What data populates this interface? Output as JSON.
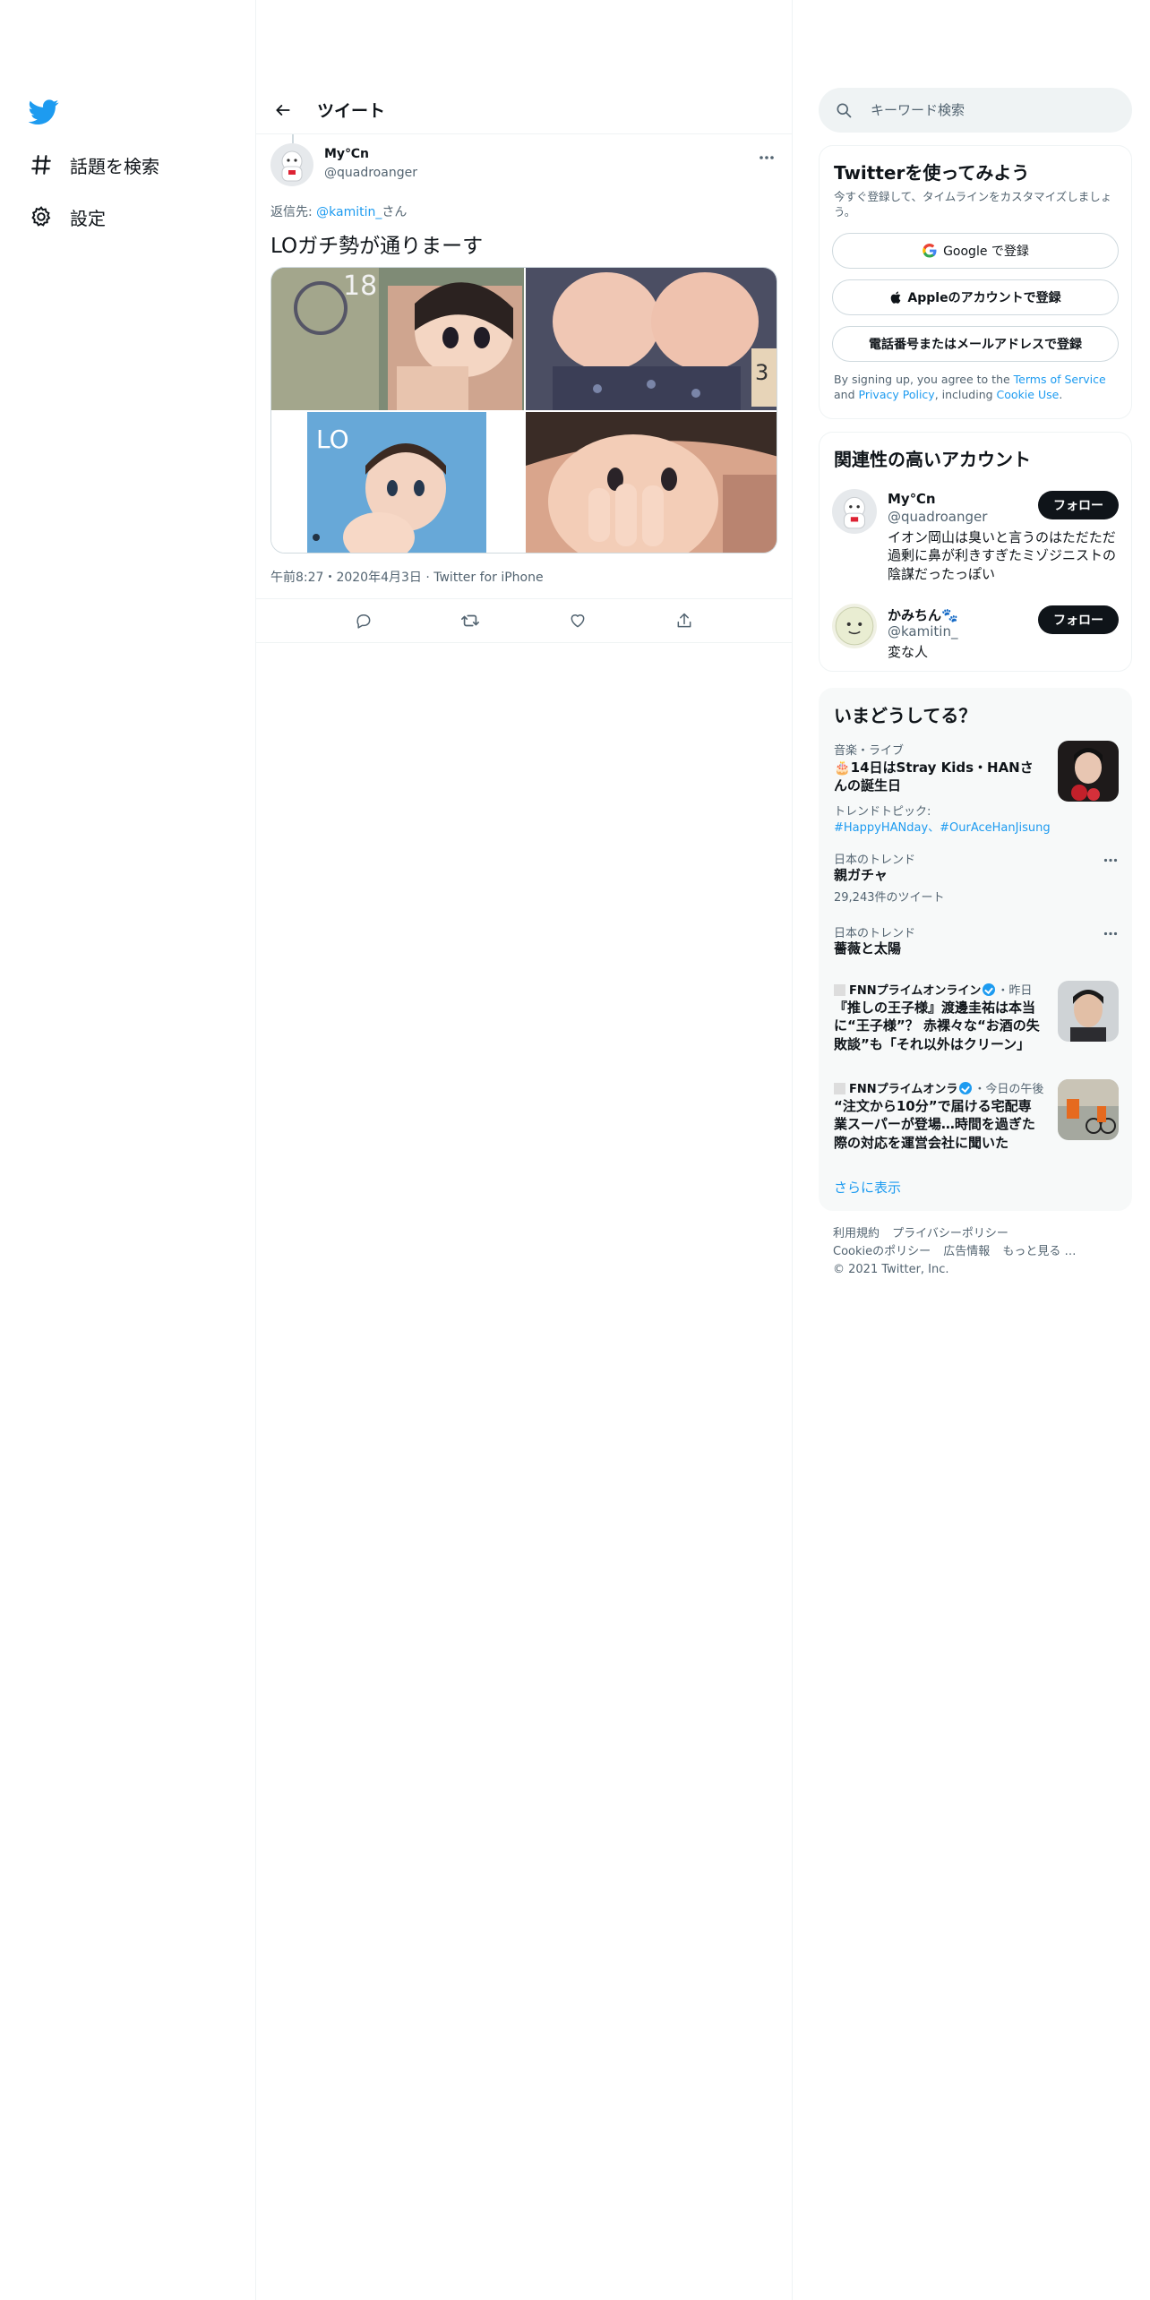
{
  "nav": {
    "explore_label": "話題を検索",
    "settings_label": "設定"
  },
  "header": {
    "title": "ツイート"
  },
  "tweet": {
    "author_name": "My℃n",
    "author_handle": "@quadroanger",
    "replying_prefix": "返信先: ",
    "replying_to": "@kamitin_",
    "replying_suffix": "さん",
    "text": "LOガチ勢が通りまーす",
    "timestamp": "午前8:27・2020年4月3日",
    "source": "Twitter for iPhone"
  },
  "search": {
    "placeholder": "キーワード検索"
  },
  "signup": {
    "title": "Twitterを使ってみよう",
    "desc": "今すぐ登録して、タイムラインをカスタマイズしましょう。",
    "google_label": "Google で登録",
    "apple_label": "Appleのアカウントで登録",
    "phone_label": "電話番号またはメールアドレスで登録",
    "terms_pre": "By signing up, you agree to the ",
    "terms_link": "Terms of Service",
    "terms_mid": " and ",
    "privacy_link": "Privacy Policy",
    "terms_mid2": ", including ",
    "cookie_link": "Cookie Use",
    "terms_end": "."
  },
  "related": {
    "title": "関連性の高いアカウント",
    "accounts": [
      {
        "name": "My℃n",
        "handle": "@quadroanger",
        "bio": "イオン岡山は臭いと言うのはただただ過剰に鼻が利きすぎたミゾジニストの陰謀だったっぽい",
        "follow": "フォロー"
      },
      {
        "name": "かみちん🐾",
        "handle": "@kamitin_",
        "bio": "変な人",
        "follow": "フォロー"
      }
    ]
  },
  "trends": {
    "title": "いまどうしてる？",
    "items": [
      {
        "meta": "音楽・ライブ",
        "title": "🎂14日はStray Kids・HANさんの誕生日",
        "tags_label": "トレンドトピック:",
        "tags": "#HappyHANday、#OurAceHanJisung"
      },
      {
        "meta": "日本のトレンド",
        "title": "親ガチャ",
        "count": "29,243件のツイート"
      },
      {
        "meta": "日本のトレンド",
        "title": "薔薇と太陽"
      },
      {
        "source": "FNNプライムオンライン",
        "time": "・昨日",
        "title": "『推しの王子様』渡邊圭祐は本当に“王子様”？ 赤裸々な“お酒の失敗談”も「それ以外はクリーン」"
      },
      {
        "source": "FNNプライムオンラ",
        "time": "・今日の午後",
        "title": "“注文から10分”で届ける宅配専業スーパーが登場…時間を過ぎた際の対応を運営会社に聞いた"
      }
    ],
    "show_more": "さらに表示"
  },
  "footer": {
    "links": [
      "利用規約",
      "プライバシーポリシー",
      "Cookieのポリシー",
      "広告情報",
      "もっと見る …"
    ],
    "copyright": "© 2021 Twitter, Inc."
  },
  "colors": {
    "accent": "#1d9bf0",
    "text": "#0f1419",
    "muted": "#536471",
    "border": "#eff3f4"
  }
}
